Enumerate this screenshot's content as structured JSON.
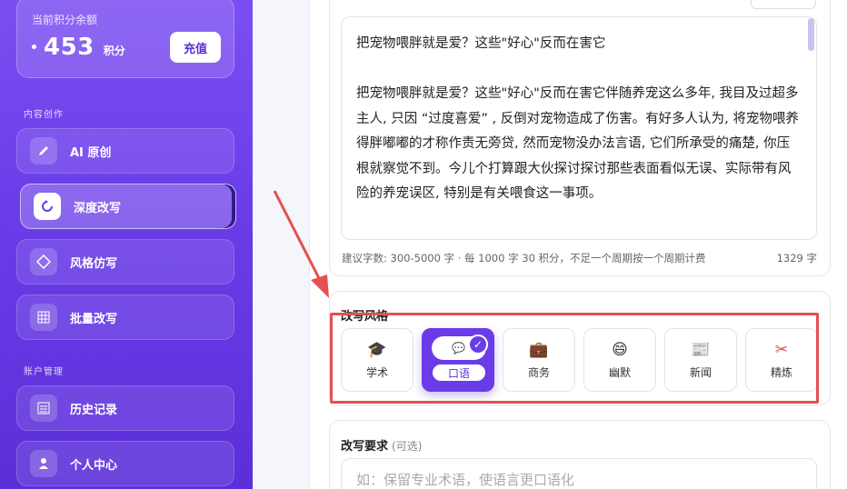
{
  "sidebar": {
    "points": {
      "label": "当前积分余额",
      "value": "453",
      "unit": "积分",
      "recharge": "充值"
    },
    "sections": {
      "create": "内容创作",
      "account": "账户管理"
    },
    "items": [
      {
        "label": "AI 原创",
        "icon": "pencil-icon"
      },
      {
        "label": "深度改写",
        "icon": "refresh-icon",
        "active": true
      },
      {
        "label": "风格仿写",
        "icon": "diamond-icon"
      },
      {
        "label": "批量改写",
        "icon": "grid-icon"
      },
      {
        "label": "历史记录",
        "icon": "list-icon"
      },
      {
        "label": "个人中心",
        "icon": "user-icon"
      }
    ]
  },
  "editor": {
    "title_line": "把宠物喂胖就是爱？这些\"好心\"反而在害它",
    "body": "把宠物喂胖就是爱？这些\"好心\"反而在害它伴随养宠这么多年, 我目及过超多主人, 只因 “过度喜爱” , 反倒对宠物造成了伤害。有好多人认为, 将宠物喂养得胖嘟嘟的才称作责无旁贷, 然而宠物没办法言语, 它们所承受的痛楚, 你压根就察觉不到。今儿个打算跟大伙探讨探讨那些表面看似无误、实际带有风险的养宠误区, 特别是有关喂食这一事项。",
    "hint": "建议字数: 300-5000 字 · 每 1000 字 30 积分，不足一个周期按一个周期计费",
    "char_count": "1329 字"
  },
  "style": {
    "title": "改写风格",
    "options": [
      {
        "label": "学术",
        "icon": "graduation-cap-icon",
        "glyph": "🎓"
      },
      {
        "label": "口语",
        "icon": "speech-bubble-icon",
        "glyph": "💬",
        "selected": true
      },
      {
        "label": "商务",
        "icon": "briefcase-icon",
        "glyph": "💼"
      },
      {
        "label": "幽默",
        "icon": "laughing-face-icon",
        "glyph": "😄"
      },
      {
        "label": "新闻",
        "icon": "newspaper-icon",
        "glyph": "📰"
      },
      {
        "label": "精炼",
        "icon": "scissors-icon",
        "glyph": "✂"
      }
    ]
  },
  "requirements": {
    "title": "改写要求",
    "optional": "(可选)",
    "placeholder": "如：保留专业术语，使语言更口语化"
  },
  "colors": {
    "accent": "#6a3ce8",
    "highlight": "#e55050"
  }
}
